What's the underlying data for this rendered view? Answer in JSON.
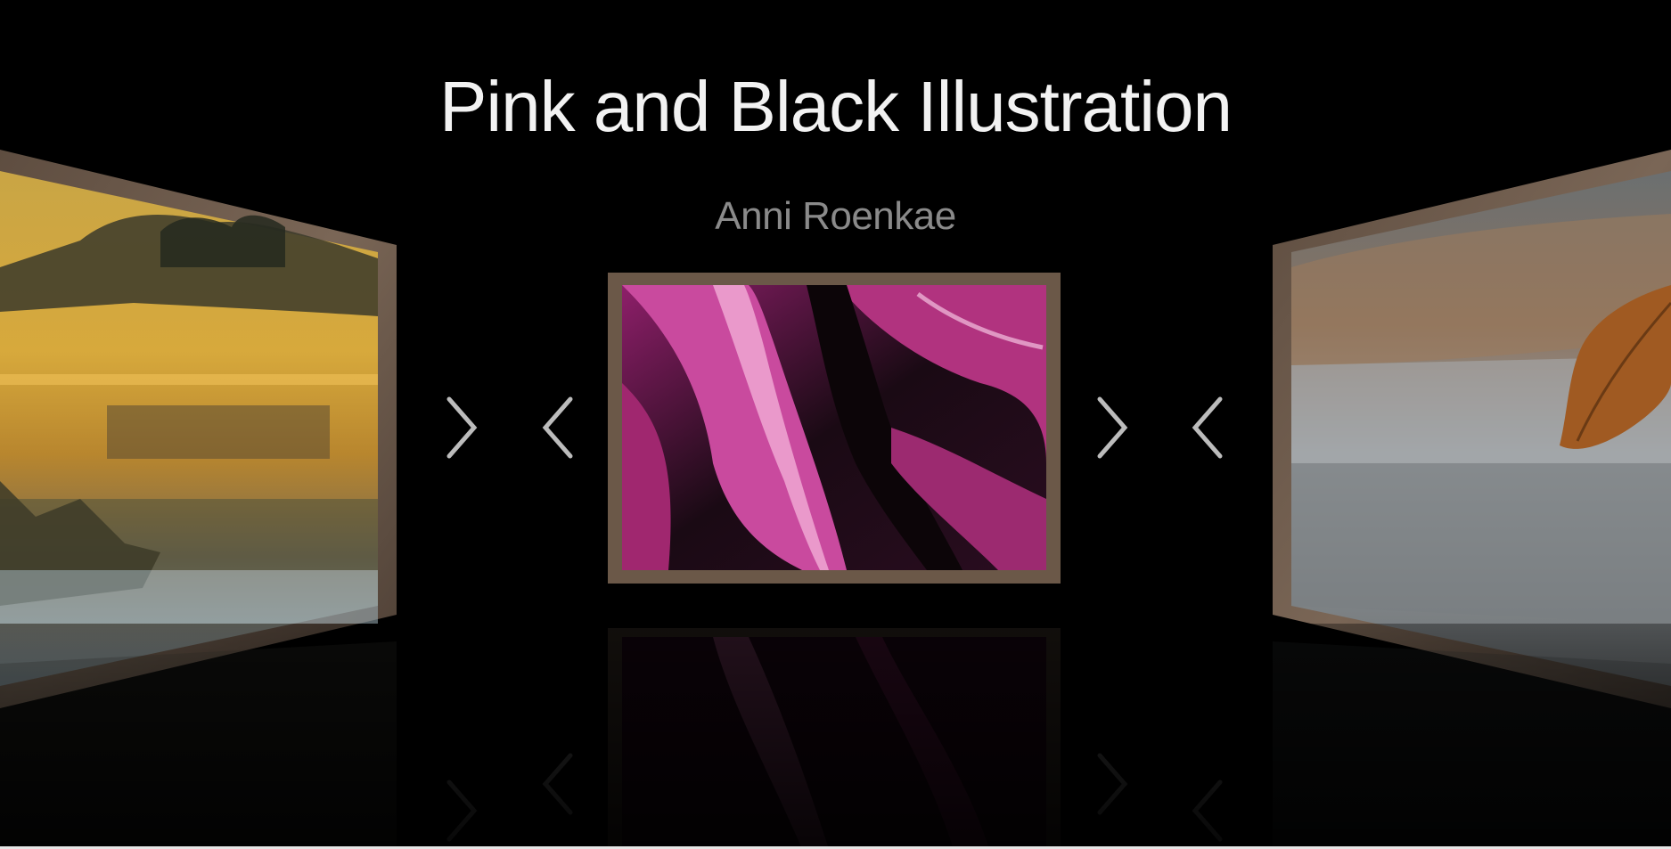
{
  "gallery": {
    "title": "Pink and Black Illustration",
    "artist": "Anni Roenkae",
    "paintings": [
      {
        "position": "left",
        "subject": "sunset lake landscape"
      },
      {
        "position": "center",
        "subject": "pink and black fluid abstract"
      },
      {
        "position": "right",
        "subject": "misty lake with autumn leaf"
      }
    ],
    "nav": {
      "next_icon": "chevron-right-icon",
      "prev_icon": "chevron-left-icon"
    },
    "colors": {
      "background": "#000000",
      "title": "#f2f2f2",
      "artist": "#8a8a8a",
      "frame": "#6b5848",
      "accent_pink": "#b0307f"
    }
  }
}
